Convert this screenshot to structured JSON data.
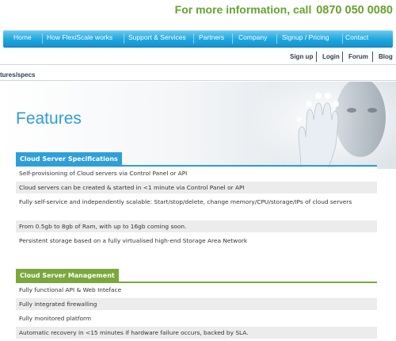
{
  "header": {
    "contact_prefix": "For more information, call",
    "phone": "0870 050 0080"
  },
  "nav": {
    "items": [
      {
        "label": "Home"
      },
      {
        "label": "How FlexiScale works"
      },
      {
        "label": "Support & Services"
      },
      {
        "label": "Partners"
      },
      {
        "label": "Company"
      },
      {
        "label": "Signup / Pricing"
      },
      {
        "label": "Contact"
      }
    ]
  },
  "utility": {
    "items": [
      {
        "label": "Sign up"
      },
      {
        "label": "Login"
      },
      {
        "label": "Forum"
      },
      {
        "label": "Blog"
      }
    ]
  },
  "breadcrumb": "tures/specs",
  "page": {
    "title": "Features"
  },
  "sections": [
    {
      "heading": "Cloud Server Specifications",
      "color": "#2e9fd8",
      "rows": [
        "Self-provisioning of Cloud servers via Control Panel or API",
        "Cloud servers can be created & started in <1 minute via Control Panel or API",
        "Fully self-service and independently scalable: Start/stop/delete, change memory/CPU/storage/IPs of cloud servers",
        "From 0.5gb to 8gb of Ram, with up to 16gb coming soon.",
        "Persistent storage based on a fully virtualised high-end Storage Area Network"
      ]
    },
    {
      "heading": "Cloud Server Management",
      "color": "#7aa83c",
      "rows": [
        "Fully functional API & Web Inteface",
        "Fully integrated firewalling",
        "Fully monitored platform",
        "Automatic recovery in <15 minutes if hardware failure occurs, backed by SLA."
      ]
    }
  ],
  "colors": {
    "brand_green": "#67a22f",
    "nav_blue": "#1ea6de",
    "title_blue": "#2f9ed6",
    "spec_blue": "#2e9fd8",
    "mgmt_green": "#7aa83c"
  }
}
